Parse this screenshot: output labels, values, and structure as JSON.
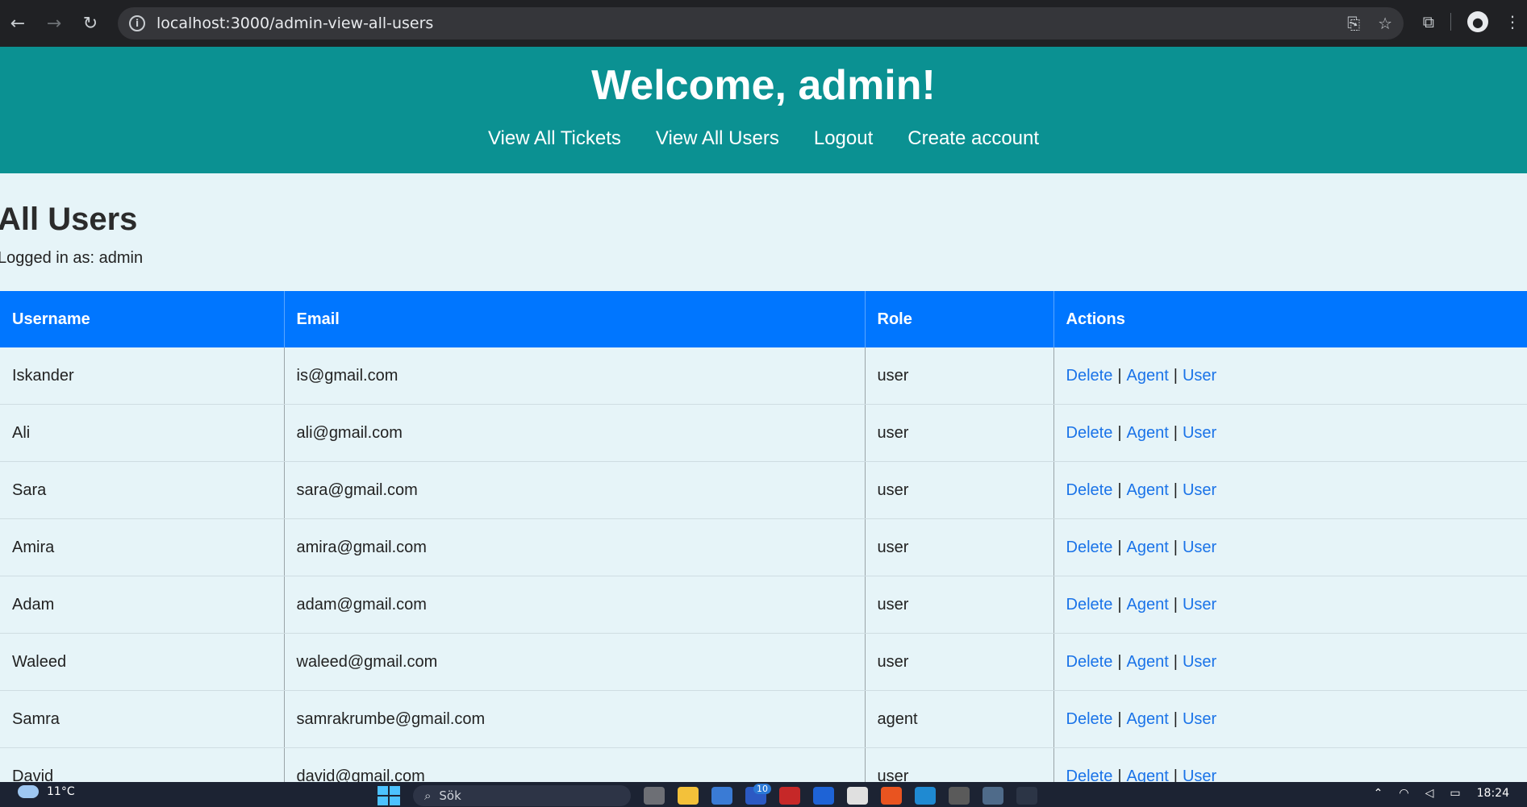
{
  "browser": {
    "url": "localhost:3000/admin-view-all-users",
    "icons": [
      "back-arrow-icon",
      "forward-arrow-icon",
      "reload-icon",
      "site-info-icon",
      "translate-icon",
      "bookmark-star-icon",
      "extensions-icon",
      "profile-icon",
      "menu-icon"
    ]
  },
  "header": {
    "title": "Welcome, admin!",
    "nav": [
      "View All Tickets",
      "View All Users",
      "Logout",
      "Create account"
    ],
    "background": "#0b9192"
  },
  "main": {
    "title": "All Users",
    "logged_in": "Logged in as: admin"
  },
  "table": {
    "columns": [
      "Username",
      "Email",
      "Role",
      "Actions"
    ],
    "header_color": "#0076ff",
    "actions": {
      "delete": "Delete",
      "sep": "|",
      "agent": "Agent",
      "user": "User"
    },
    "rows": [
      {
        "username": "Iskander",
        "email": "is@gmail.com",
        "role": "user"
      },
      {
        "username": "Ali",
        "email": "ali@gmail.com",
        "role": "user"
      },
      {
        "username": "Sara",
        "email": "sara@gmail.com",
        "role": "user"
      },
      {
        "username": "Amira",
        "email": "amira@gmail.com",
        "role": "user"
      },
      {
        "username": "Adam",
        "email": "adam@gmail.com",
        "role": "user"
      },
      {
        "username": "Waleed",
        "email": "waleed@gmail.com",
        "role": "user"
      },
      {
        "username": "Samra",
        "email": "samrakrumbe@gmail.com",
        "role": "agent"
      },
      {
        "username": "David",
        "email": "david@gmail.com",
        "role": "user"
      }
    ]
  },
  "taskbar": {
    "temperature": "11°C",
    "search_placeholder": "Sök",
    "badge_count": "10",
    "time": "18:24"
  }
}
